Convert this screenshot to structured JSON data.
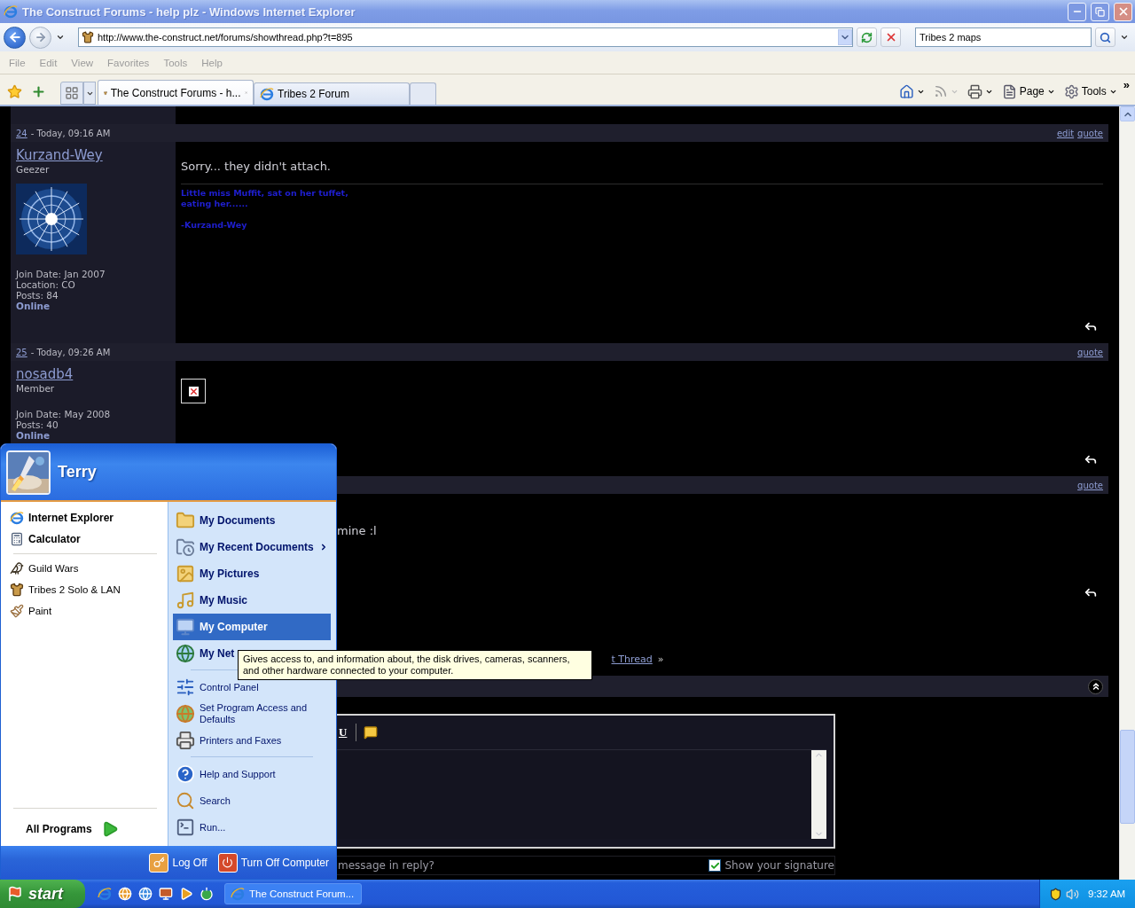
{
  "window": {
    "title": "The Construct Forums - help plz - Windows Internet Explorer"
  },
  "address_bar": {
    "url": "http://www.the-construct.net/forums/showthread.php?t=895"
  },
  "search_box": {
    "value": "Tribes 2 maps"
  },
  "menu_bar": [
    "File",
    "Edit",
    "View",
    "Favorites",
    "Tools",
    "Help"
  ],
  "tabs": [
    {
      "label": "The Construct Forums - h...",
      "selected": true
    },
    {
      "label": "Tribes 2 Forum",
      "selected": false
    }
  ],
  "command_bar": {
    "labels": [
      "Page",
      "Tools"
    ],
    "overflow": "»"
  },
  "posts": [
    {
      "number": "24",
      "date": "- Today, 09:16 AM",
      "actions": [
        "edit",
        "quote"
      ],
      "user": {
        "name": "Kurzand-Wey",
        "title": "Geezer",
        "avatar": true,
        "details": [
          "Join Date: Jan 2007",
          "Location: CO",
          "Posts: 84"
        ],
        "status": "Online"
      },
      "message": {
        "kind": "text",
        "text": "Sorry... they didn't attach.",
        "covered": false
      },
      "signature": {
        "verse": [
          "Little miss Muffit, sat on her tuffet,",
          "eating her......"
        ],
        "sign": "-Kurzand-Wey"
      }
    },
    {
      "number": "25",
      "date": "- Today, 09:26 AM",
      "actions": [
        "quote"
      ],
      "user": {
        "name": "nosadb4",
        "title": "Member",
        "avatar": false,
        "details": [
          "Join Date: May 2008",
          "Posts: 40"
        ],
        "status": "Online"
      },
      "message": {
        "kind": "broken_image"
      }
    },
    {
      "actions": [
        "quote"
      ],
      "message": {
        "kind": "text",
        "text": "mine :l",
        "covered": true
      }
    }
  ],
  "thread_nav": {
    "link": "t Thread",
    "arrow": "»"
  },
  "quick_reply": {
    "toolbar": [
      "U"
    ],
    "question": "message in reply?",
    "signature_option": {
      "label": "Show your signature",
      "checked": true
    }
  },
  "start_menu": {
    "user": "Terry",
    "pinned": [
      {
        "label": "Internet Explorer",
        "selected": false
      },
      {
        "label": "Calculator",
        "selected": false
      }
    ],
    "recent": [
      {
        "label": "Guild Wars",
        "selected": false
      },
      {
        "label": "Tribes 2 Solo & LAN",
        "selected": false
      },
      {
        "label": "Paint",
        "selected": false
      }
    ],
    "all_programs": "All Programs",
    "places": [
      {
        "label": "My Documents",
        "selected": false,
        "submenu": false
      },
      {
        "label": "My Recent Documents",
        "selected": false,
        "submenu": true
      },
      {
        "label": "My Pictures",
        "selected": false,
        "submenu": false
      },
      {
        "label": "My Music",
        "selected": false,
        "submenu": false
      },
      {
        "label": "My Computer",
        "selected": true,
        "submenu": false
      },
      {
        "label": "My Net",
        "selected": false,
        "submenu": false
      }
    ],
    "settings": [
      {
        "label": "Control Panel",
        "selected": false
      },
      {
        "label": "Set Program Access and Defaults",
        "selected": false
      },
      {
        "label": "Printers and Faxes",
        "selected": false
      }
    ],
    "tools": [
      {
        "label": "Help and Support",
        "selected": false
      },
      {
        "label": "Search",
        "selected": false
      },
      {
        "label": "Run...",
        "selected": false
      }
    ],
    "footer": [
      "Log Off",
      "Turn Off Computer"
    ]
  },
  "tooltip": {
    "text": "Gives access to, and information about, the disk drives, cameras, scanners, and other hardware connected to your computer."
  },
  "taskbar": {
    "start": "start",
    "tasks": [
      {
        "label": "The Construct Forum...",
        "selected": false
      }
    ],
    "clock": "9:32 AM"
  }
}
